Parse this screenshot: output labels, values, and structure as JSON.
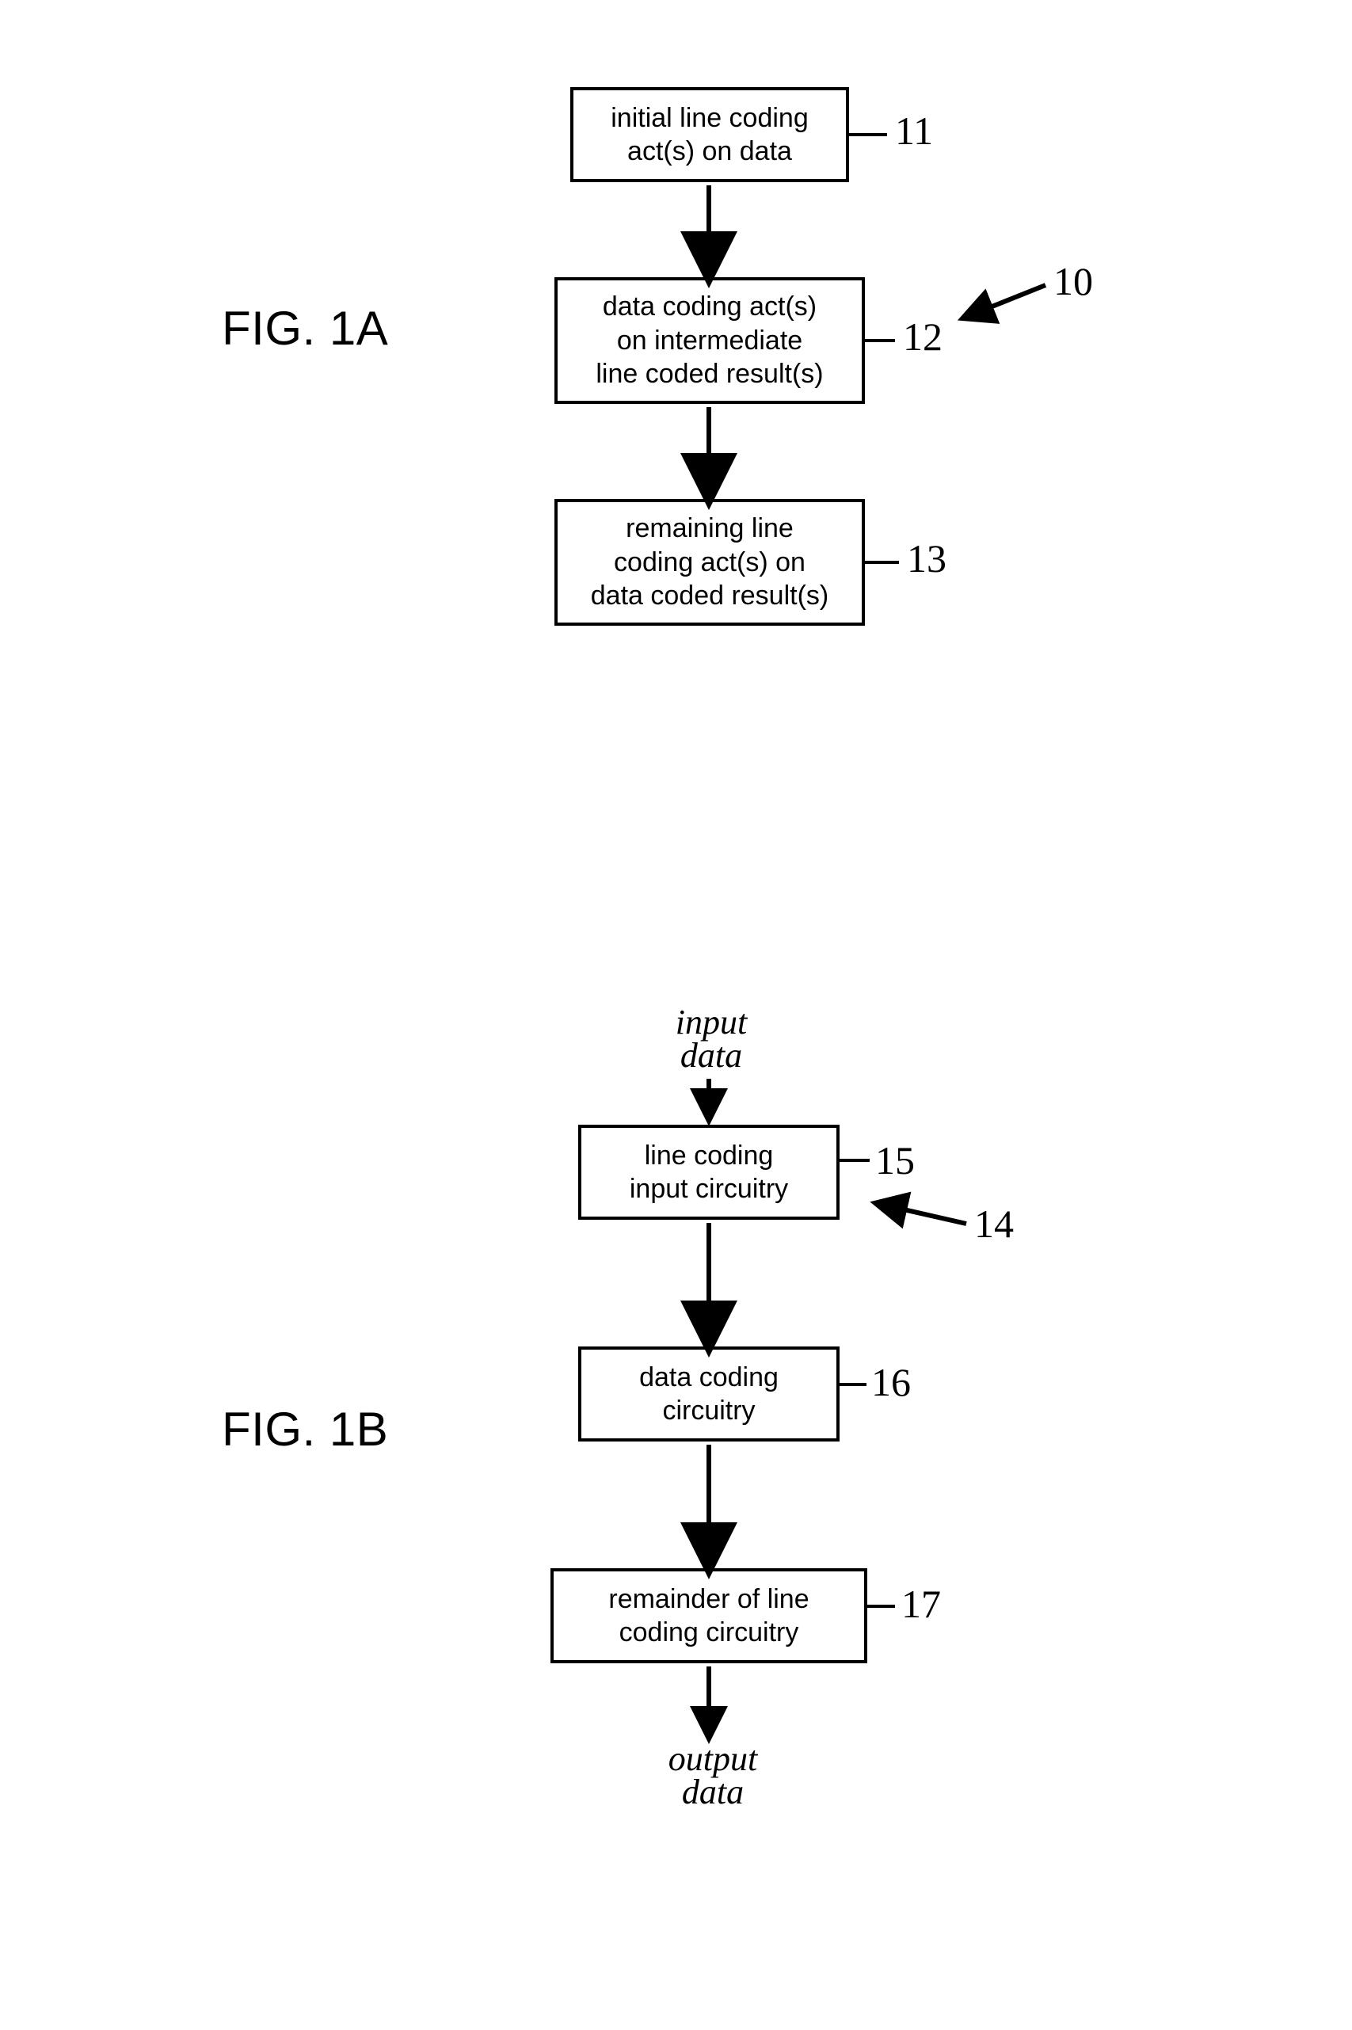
{
  "figA": {
    "label": "FIG. 1A",
    "ref_group": "10",
    "boxes": {
      "b11": {
        "text": "initial line coding\nact(s) on data",
        "ref": "11"
      },
      "b12": {
        "text": "data coding act(s)\non intermediate\nline coded result(s)",
        "ref": "12"
      },
      "b13": {
        "text": "remaining line\ncoding act(s) on\ndata coded result(s)",
        "ref": "13"
      }
    }
  },
  "figB": {
    "label": "FIG. 1B",
    "ref_group": "14",
    "input_label": "input\ndata",
    "output_label": "output\ndata",
    "boxes": {
      "b15": {
        "text": "line coding\ninput circuitry",
        "ref": "15"
      },
      "b16": {
        "text": "data coding\ncircuitry",
        "ref": "16"
      },
      "b17": {
        "text": "remainder of line\ncoding circuitry",
        "ref": "17"
      }
    }
  }
}
